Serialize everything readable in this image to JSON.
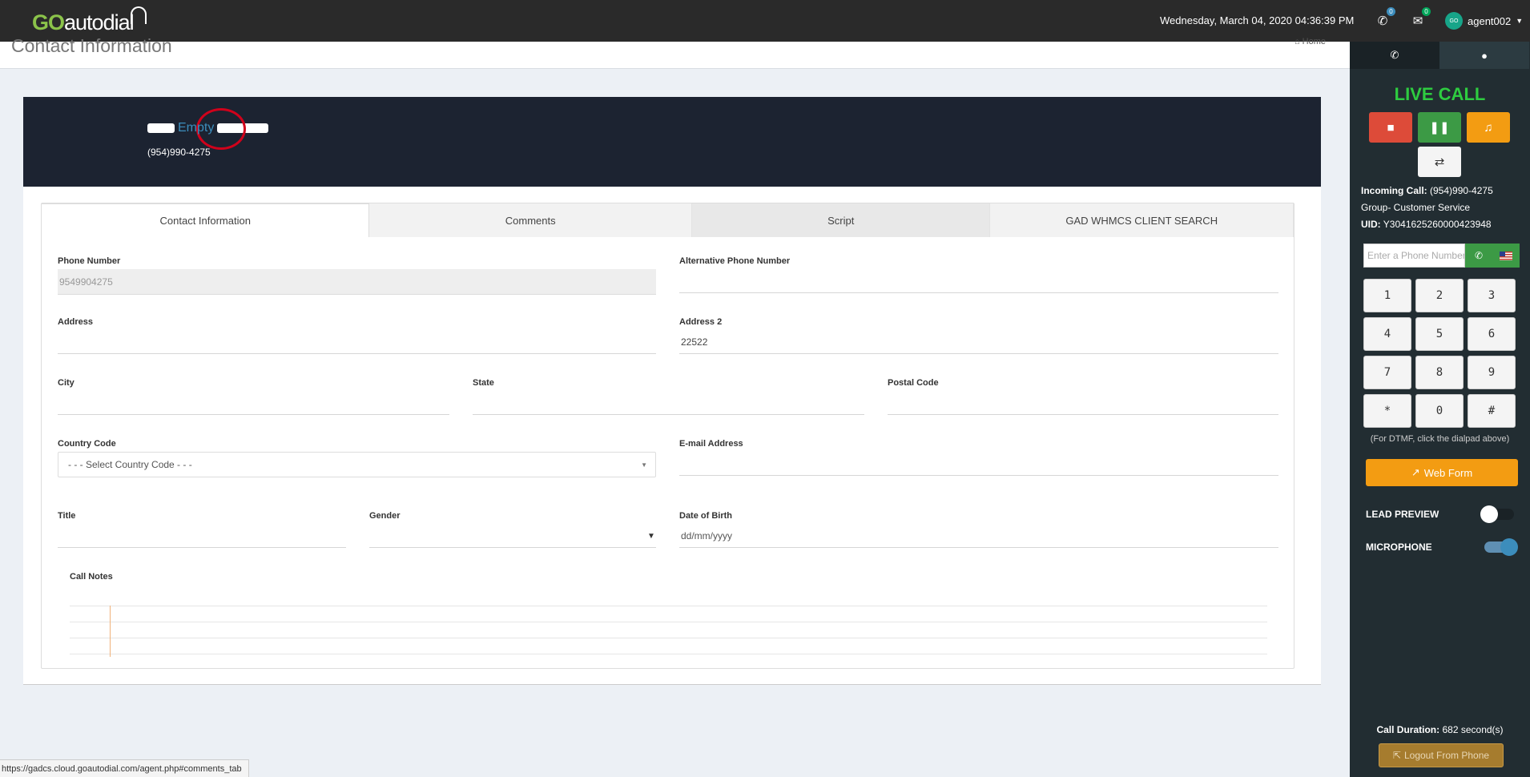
{
  "brand": {
    "go": "GO",
    "rest": "autodial"
  },
  "header": {
    "datetime": "Wednesday, March 04, 2020 04:36:39 PM",
    "calls_badge": "0",
    "messages_badge": "0",
    "avatar_text": "GO",
    "username": "agent002"
  },
  "page": {
    "title": "Contact Information",
    "breadcrumb_home": "Home"
  },
  "banner": {
    "name_value": "Empty",
    "phone": "(954)990-4275"
  },
  "tabs": [
    {
      "label": "Contact Information"
    },
    {
      "label": "Comments"
    },
    {
      "label": "Script"
    },
    {
      "label": "GAD WHMCS CLIENT SEARCH"
    }
  ],
  "form": {
    "phone_label": "Phone Number",
    "phone_value": "9549904275",
    "alt_phone_label": "Alternative Phone Number",
    "alt_phone_value": "",
    "address_label": "Address",
    "address_value": "",
    "address2_label": "Address 2",
    "address2_value": "22522",
    "city_label": "City",
    "state_label": "State",
    "postal_label": "Postal Code",
    "country_label": "Country Code",
    "country_value": "- - - Select Country Code - - -",
    "email_label": "E-mail Address",
    "title_label": "Title",
    "gender_label": "Gender",
    "dob_label": "Date of Birth",
    "dob_placeholder": "dd/mm/yyyy",
    "notes_label": "Call Notes"
  },
  "panel": {
    "live_call": "LIVE CALL",
    "incoming_label": "Incoming Call:",
    "incoming_value": "(954)990-4275",
    "group": "Group- Customer Service",
    "uid_label": "UID:",
    "uid_value": "Y3041625260000423948",
    "dial_placeholder": "Enter a Phone Number",
    "keys": [
      "1",
      "2",
      "3",
      "4",
      "5",
      "6",
      "7",
      "8",
      "9",
      "*",
      "0",
      "#"
    ],
    "dtmf_note": "(For DTMF, click the dialpad above)",
    "web_form": "Web Form",
    "lead_preview": "LEAD PREVIEW",
    "microphone": "MICROPHONE",
    "duration_label": "Call Duration:",
    "duration_value": "682 second(s)",
    "logout": "Logout From Phone"
  },
  "status_url": "https://gadcs.cloud.goautodial.com/agent.php#comments_tab",
  "colors": {
    "topbar": "#2a2a2a",
    "panel": "#222d32",
    "live_green": "#2ecc40",
    "stop_red": "#dd4b39",
    "pause_green": "#3c9a45",
    "music_orange": "#f39c12",
    "highlight_circle": "#d0021b"
  }
}
